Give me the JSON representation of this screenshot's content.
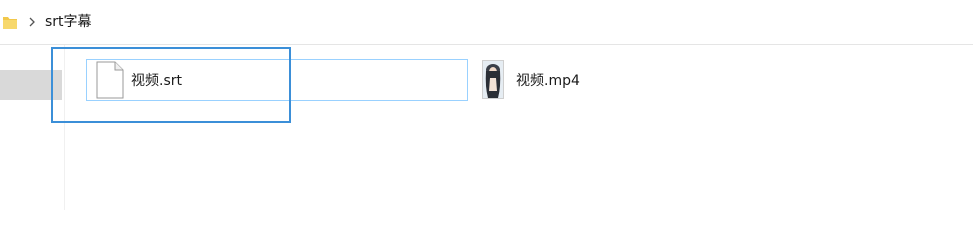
{
  "address_bar": {
    "breadcrumb": "srt字幕",
    "folder_icon": "folder-icon",
    "separator_icon": "chevron-right-icon"
  },
  "files": [
    {
      "name": "视频.srt",
      "icon": "document-icon",
      "selected": false
    },
    {
      "name": "视频.mp4",
      "icon": "video-thumbnail",
      "selected": false
    }
  ],
  "colors": {
    "highlight_border": "#3b8fd8",
    "hover_border": "#99d1ff",
    "nav_selected": "#d9d9d9",
    "folder_yellow": "#f2c84b"
  }
}
